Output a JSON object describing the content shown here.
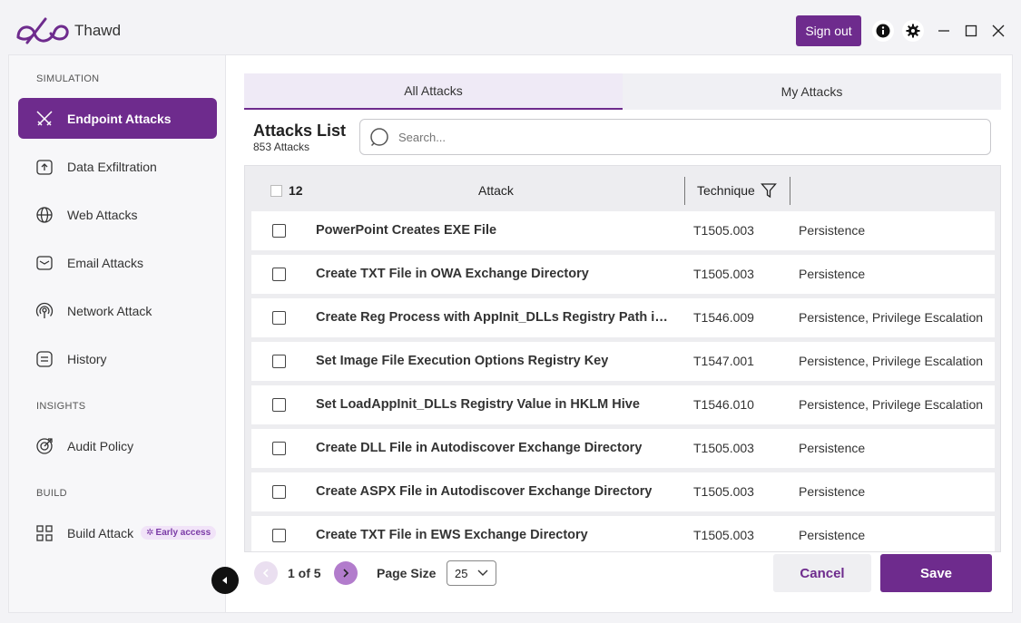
{
  "app": {
    "name": "Thawd",
    "sign_out": "Sign out"
  },
  "colors": {
    "accent": "#6e2b8d",
    "accent_light": "#b27ccc"
  },
  "sidebar": {
    "sections": [
      {
        "label": "SIMULATION"
      },
      {
        "label": "INSIGHTS"
      },
      {
        "label": "BUILD"
      }
    ],
    "items": [
      {
        "label": "Endpoint Attacks",
        "icon": "swords-icon",
        "active": true
      },
      {
        "label": "Data Exfiltration",
        "icon": "upload-icon"
      },
      {
        "label": "Web Attacks",
        "icon": "globe-icon"
      },
      {
        "label": "Email Attacks",
        "icon": "mail-icon"
      },
      {
        "label": "Network Attack",
        "icon": "broadcast-icon"
      },
      {
        "label": "History",
        "icon": "history-icon"
      },
      {
        "label": "Audit Policy",
        "icon": "target-icon"
      },
      {
        "label": "Build Attack",
        "icon": "grid-icon",
        "badge": "Early access"
      }
    ]
  },
  "tabs": [
    {
      "label": "All Attacks",
      "active": true
    },
    {
      "label": "My Attacks"
    }
  ],
  "list": {
    "title": "Attacks List",
    "count": "853 Attacks",
    "search_placeholder": "Search..."
  },
  "table": {
    "selected_count": "12",
    "columns": {
      "attack": "Attack",
      "technique": "Technique"
    },
    "rows": [
      {
        "attack": "PowerPoint Creates EXE File",
        "technique": "T1505.003",
        "tactic": "Persistence"
      },
      {
        "attack": "Create TXT File in OWA Exchange Directory",
        "technique": "T1505.003",
        "tactic": "Persistence"
      },
      {
        "attack": "Create Reg Process with AppInit_DLLs Registry Path in...",
        "technique": "T1546.009",
        "tactic": "Persistence, Privilege Escalation"
      },
      {
        "attack": "Set Image File Execution Options Registry Key",
        "technique": "T1547.001",
        "tactic": "Persistence, Privilege Escalation"
      },
      {
        "attack": "Set LoadAppInit_DLLs Registry Value in HKLM Hive",
        "technique": "T1546.010",
        "tactic": "Persistence, Privilege Escalation"
      },
      {
        "attack": "Create DLL File in Autodiscover Exchange Directory",
        "technique": "T1505.003",
        "tactic": "Persistence"
      },
      {
        "attack": "Create ASPX File in Autodiscover Exchange Directory",
        "technique": "T1505.003",
        "tactic": "Persistence"
      },
      {
        "attack": "Create TXT File in EWS Exchange Directory",
        "technique": "T1505.003",
        "tactic": "Persistence"
      }
    ]
  },
  "pagination": {
    "page_text": "1 of 5",
    "page_size_label": "Page Size",
    "page_size": "25"
  },
  "actions": {
    "cancel": "Cancel",
    "save": "Save"
  }
}
